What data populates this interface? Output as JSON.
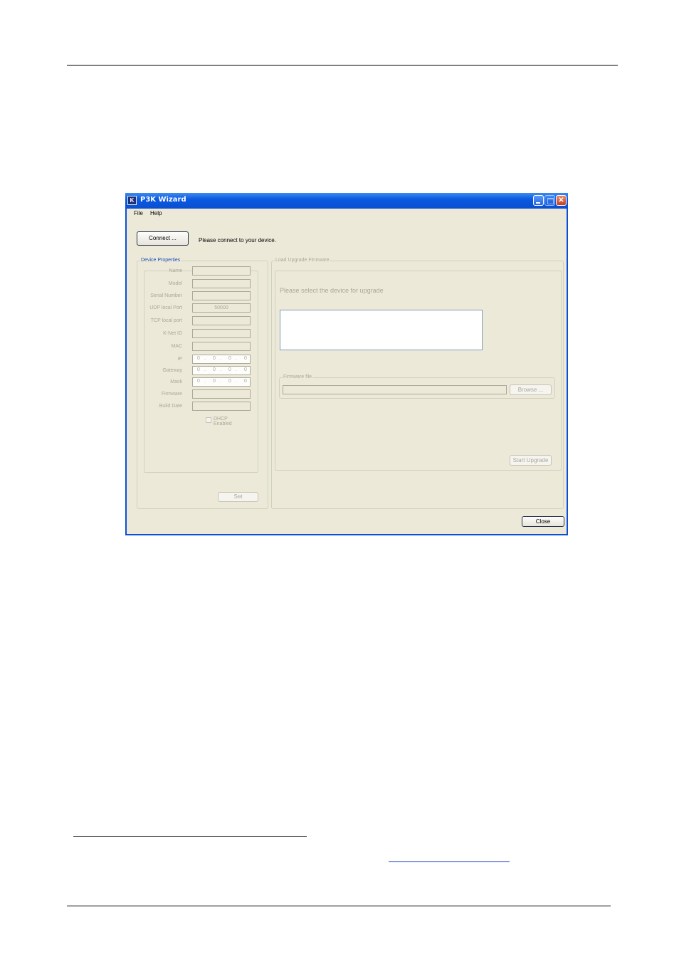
{
  "window": {
    "title": "P3K Wizard",
    "app_icon_letter": "K"
  },
  "menu": [
    "File",
    "Help"
  ],
  "connect": {
    "button_label": "Connect ...",
    "status": "Please connect to your device."
  },
  "device_properties": {
    "title": "Device Properties",
    "fields": [
      {
        "label": "Name",
        "value": ""
      },
      {
        "label": "Model",
        "value": ""
      },
      {
        "label": "Serial Number",
        "value": ""
      },
      {
        "label": "UDP local Port",
        "value": "50000"
      },
      {
        "label": "TCP local port",
        "value": ""
      },
      {
        "label": "K-Net ID",
        "value": ""
      },
      {
        "label": "MAC",
        "value": ""
      }
    ],
    "ip_fields": [
      {
        "label": "IP",
        "octets": [
          "0",
          "0",
          "0",
          "0"
        ]
      },
      {
        "label": "Gateway",
        "octets": [
          "0",
          "0",
          "0",
          "0"
        ]
      },
      {
        "label": "Mask",
        "octets": [
          "0",
          "0",
          "0",
          "0"
        ]
      }
    ],
    "fields_after": [
      {
        "label": "Firmware",
        "value": ""
      },
      {
        "label": "Build Date",
        "value": ""
      }
    ],
    "dhcp_label": "DHCP Enabled",
    "set_button": "Set"
  },
  "upgrade": {
    "title": "Load Upgrade Firmware",
    "instruction": "Please select the device for upgrade",
    "firmware_group_title": "Firmware file",
    "browse_button": "Browse ...",
    "start_button": "Start Upgrade"
  },
  "close_button": "Close"
}
